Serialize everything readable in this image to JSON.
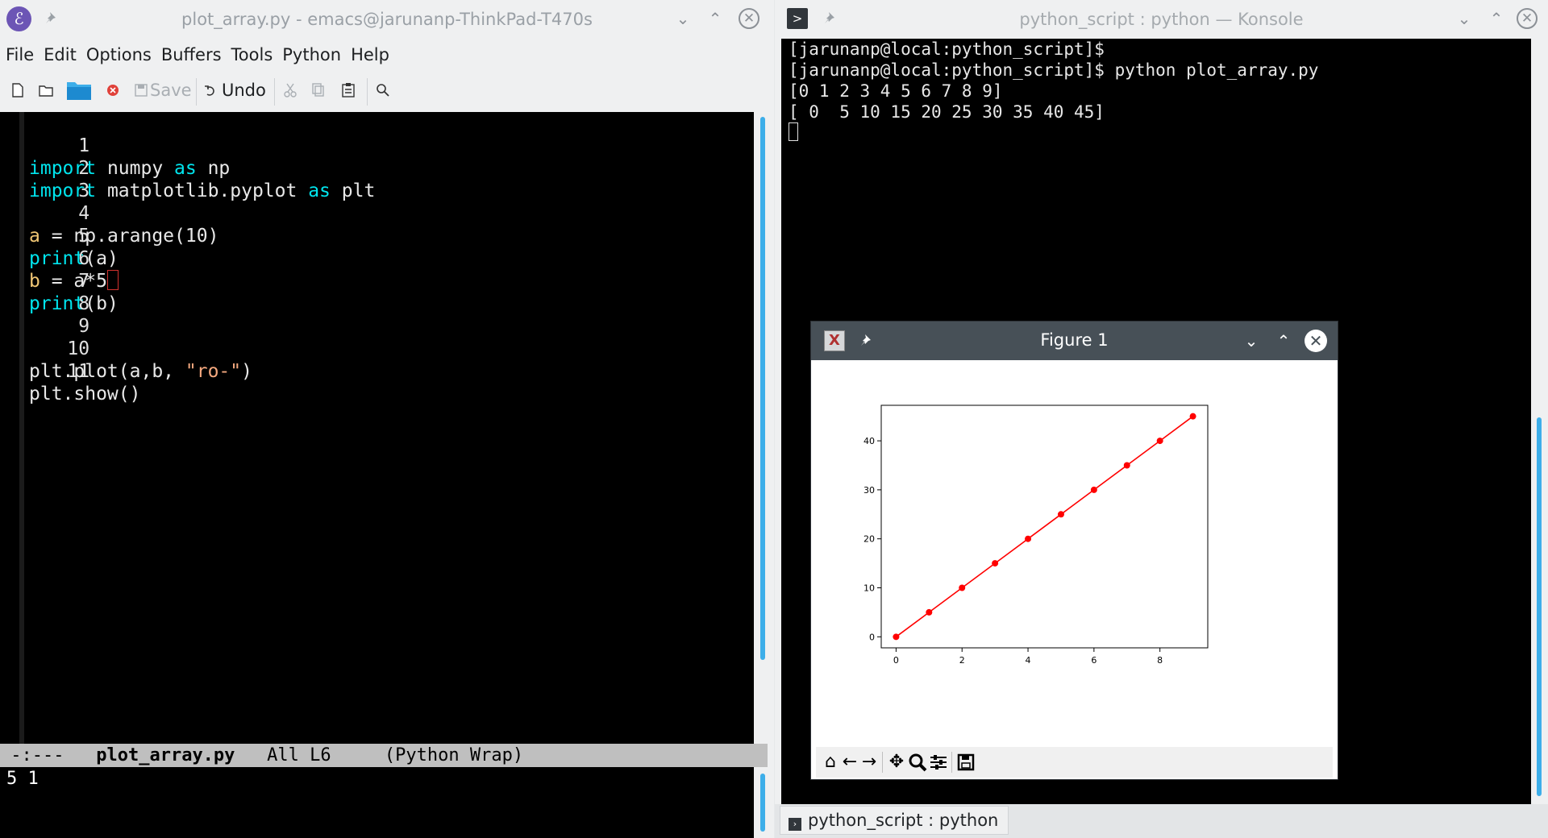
{
  "emacs": {
    "title": "plot_array.py - emacs@jarunanp-ThinkPad-T470s",
    "menu": [
      "File",
      "Edit",
      "Options",
      "Buffers",
      "Tools",
      "Python",
      "Help"
    ],
    "toolbar": {
      "save_label": "Save",
      "undo_label": "Undo"
    },
    "lines": [
      {
        "n": "1"
      },
      {
        "n": "2"
      },
      {
        "n": "3"
      },
      {
        "n": "4"
      },
      {
        "n": "5"
      },
      {
        "n": "6"
      },
      {
        "n": "7"
      },
      {
        "n": "8"
      },
      {
        "n": "9"
      },
      {
        "n": "10"
      },
      {
        "n": "11"
      }
    ],
    "code": {
      "l1_kw1": "import",
      "l1_mod": " numpy ",
      "l1_kw2": "as",
      "l1_alias": " np",
      "l2_kw1": "import",
      "l2_mod": " matplotlib.pyplot ",
      "l2_kw2": "as",
      "l2_alias": " plt",
      "l4_var": "a",
      "l4_rest": " = np.arange(10)",
      "l5_fn": "print",
      "l5_rest": "(a)",
      "l6_var": "b",
      "l6_rest": " = a*5",
      "l7_fn": "print",
      "l7_rest": "(b)",
      "l10_pre": "plt.plot(a,b, ",
      "l10_str": "\"ro-\"",
      "l10_post": ")",
      "l11": "plt.show()"
    },
    "modeline": {
      "status": "-:---",
      "buffer": "plot_array.py",
      "position": "All L6",
      "modes": "(Python Wrap)"
    },
    "minibuffer": "5 1"
  },
  "konsole": {
    "title": "python_script : python — Konsole",
    "lines": [
      "[jarunanp@local:python_script]$",
      "[jarunanp@local:python_script]$ python plot_array.py",
      "[0 1 2 3 4 5 6 7 8 9]",
      "[ 0  5 10 15 20 25 30 35 40 45]"
    ],
    "tab_label": "python_script : python"
  },
  "figure": {
    "title": "Figure 1"
  },
  "chart_data": {
    "type": "line",
    "x": [
      0,
      1,
      2,
      3,
      4,
      5,
      6,
      7,
      8,
      9
    ],
    "series": [
      {
        "values": [
          0,
          5,
          10,
          15,
          20,
          25,
          30,
          35,
          40,
          45
        ],
        "color": "#ff0000",
        "marker": "o"
      }
    ],
    "xticks": [
      "0",
      "2",
      "4",
      "6",
      "8"
    ],
    "yticks": [
      "0",
      "10",
      "20",
      "30",
      "40"
    ],
    "xlim": [
      -0.45,
      9.45
    ],
    "ylim": [
      -2.25,
      47.25
    ],
    "grid": false,
    "title": "",
    "xlabel": "",
    "ylabel": ""
  }
}
